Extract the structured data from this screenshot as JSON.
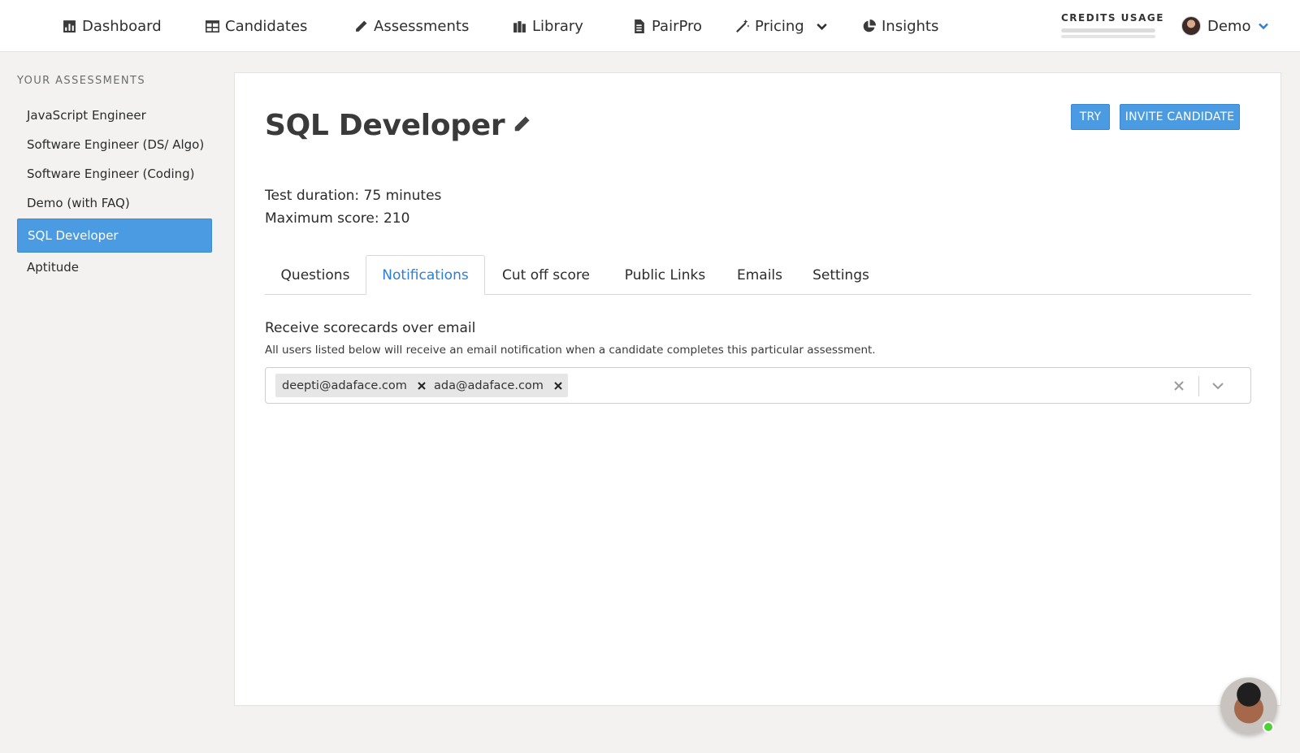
{
  "nav": {
    "items": [
      {
        "label": "Dashboard",
        "icon": "bar-chart-icon"
      },
      {
        "label": "Candidates",
        "icon": "table-icon"
      },
      {
        "label": "Assessments",
        "icon": "pencil-icon"
      },
      {
        "label": "Library",
        "icon": "books-icon"
      },
      {
        "label": "PairPro",
        "icon": "file-icon"
      },
      {
        "label": "Pricing",
        "icon": "magic-wand-icon"
      },
      {
        "label": "Insights",
        "icon": "pie-chart-icon"
      }
    ],
    "credits_label": "CREDITS USAGE",
    "user_name": "Demo"
  },
  "sidebar": {
    "heading": "YOUR ASSESSMENTS",
    "items": [
      {
        "label": "JavaScript Engineer"
      },
      {
        "label": "Software Engineer (DS/ Algo)"
      },
      {
        "label": "Software Engineer (Coding)"
      },
      {
        "label": "Demo (with FAQ)"
      },
      {
        "label": "SQL Developer",
        "active": true
      },
      {
        "label": "Aptitude"
      }
    ]
  },
  "assessment": {
    "title": "SQL Developer",
    "try_label": "TRY",
    "invite_label": "INVITE CANDIDATE",
    "duration": "Test duration: 75 minutes",
    "max_score": "Maximum score: 210"
  },
  "tabs": [
    {
      "label": "Questions"
    },
    {
      "label": "Notifications",
      "active": true
    },
    {
      "label": "Cut off score"
    },
    {
      "label": "Public Links"
    },
    {
      "label": "Emails"
    },
    {
      "label": "Settings"
    }
  ],
  "notifications": {
    "title": "Receive scorecards over email",
    "description": "All users listed below will receive an email notification when a candidate completes this particular assessment.",
    "recipients": [
      "deepti@adaface.com",
      "ada@adaface.com"
    ]
  },
  "colors": {
    "accent": "#4b9be3",
    "active_tab_text": "#2b7fd6",
    "online": "#4cd137"
  }
}
